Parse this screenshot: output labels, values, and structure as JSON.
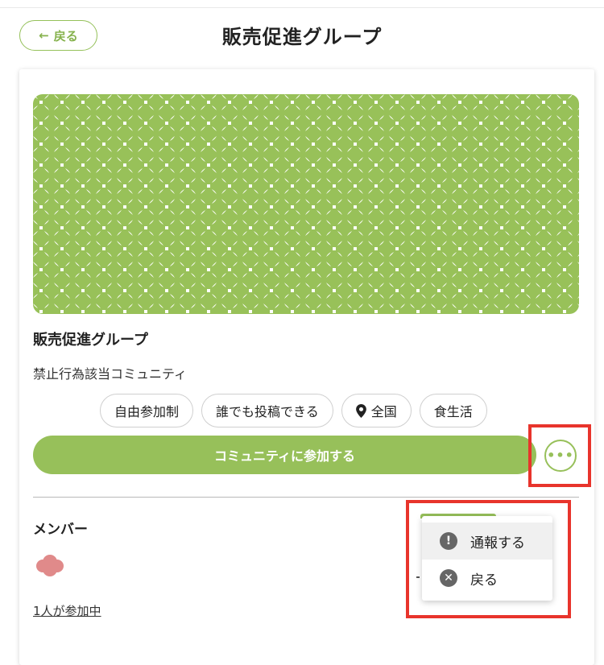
{
  "header": {
    "back_label": "戻る",
    "back_arrow": "←",
    "title": "販売促進グループ"
  },
  "community": {
    "name": "販売促進グループ",
    "description": "禁止行為該当コミュニティ",
    "tags": [
      "自由参加制",
      "誰でも投稿できる",
      "全国",
      "食生活"
    ],
    "join_label": "コミュニティに参加する",
    "more_label": "•••"
  },
  "members": {
    "heading": "メンバー",
    "count_text": "1人が参加中"
  },
  "menu": {
    "items": [
      {
        "label": "通報する",
        "icon": "exclamation-circle-icon",
        "glyph": "!"
      },
      {
        "label": "戻る",
        "icon": "close-circle-icon",
        "glyph": "✕"
      }
    ]
  },
  "colors": {
    "brand_green": "#97c05a",
    "highlight_red": "#e8342c",
    "avatar_pink": "#e08a8a"
  }
}
